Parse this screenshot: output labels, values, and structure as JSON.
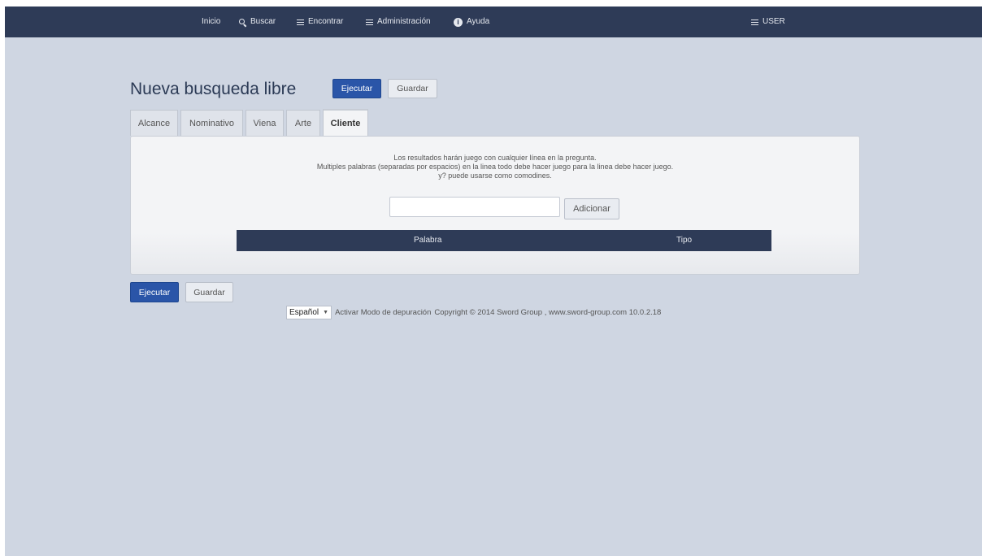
{
  "nav": {
    "home": "Inicio",
    "search": "Buscar",
    "find": "Encontrar",
    "admin": "Administración",
    "help": "Ayuda",
    "user": "USER"
  },
  "page": {
    "title": "Nueva busqueda libre",
    "run_label": "Ejecutar",
    "save_label": "Guardar"
  },
  "tabs": [
    {
      "label": "Alcance"
    },
    {
      "label": "Nominativo"
    },
    {
      "label": "Viena"
    },
    {
      "label": "Arte"
    },
    {
      "label": "Cliente",
      "active": true
    }
  ],
  "panel": {
    "info_line1": "Los resultados harán juego con cualquier línea en la pregunta.",
    "info_line2": "Multiples palabras (separadas por espacios) en la linea todo debe hacer juego para la linea debe hacer juego.",
    "info_line3": "y? puede usarse como comodines.",
    "input_value": "",
    "add_label": "Adicionar",
    "columns": [
      "Palabra",
      "Tipo"
    ]
  },
  "bottom": {
    "run_label": "Ejecutar",
    "save_label": "Guardar"
  },
  "footer": {
    "language": "Español",
    "debug_link": "Activar Modo de depuración",
    "copyright": "Copyright © 2014 Sword Group , www.sword-group.com 10.0.2.18"
  },
  "colors": {
    "navbar": "#2e3b57",
    "background": "#cfd6e2",
    "primary": "#2a55a8"
  }
}
